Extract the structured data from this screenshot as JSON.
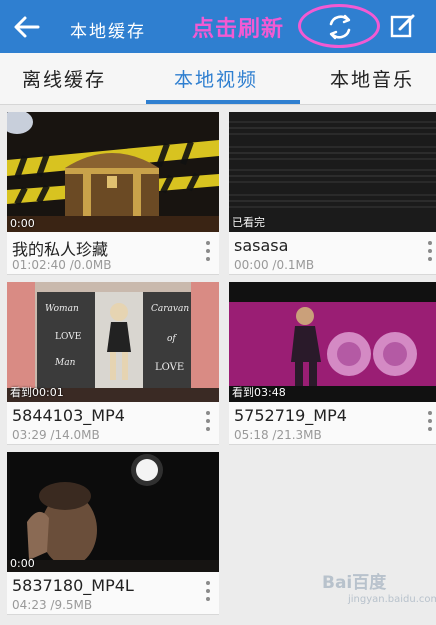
{
  "header": {
    "title": "本地缓存",
    "annotation": "点击刷新"
  },
  "tabs": [
    {
      "label": "离线缓存"
    },
    {
      "label": "本地视频"
    },
    {
      "label": "本地音乐"
    }
  ],
  "videos": [
    {
      "title": "我的私人珍藏",
      "meta": "01:02:40 /0.0MB",
      "status": "0:00"
    },
    {
      "title": "sasasa",
      "meta": "00:00 /0.1MB",
      "status": "已看完"
    },
    {
      "title": "5844103_MP4",
      "meta": "03:29 /14.0MB",
      "status": "看到00:01"
    },
    {
      "title": "5752719_MP4",
      "meta": "05:18 /21.3MB",
      "status": "看到03:48"
    },
    {
      "title": "5837180_MP4L",
      "meta": "04:23 /9.5MB",
      "status": "0:00"
    }
  ],
  "thumbnail_overlay_text": {
    "woman": "Woman",
    "love": "LOVE",
    "man": "Man",
    "caravan": "Caravan",
    "of": "of",
    "love2": "LOVE"
  },
  "watermark": {
    "brand": "Bai百度",
    "sub": "jingyan.baidu.com"
  },
  "colors": {
    "accent": "#2f7fd0",
    "annotation": "#f25ad3"
  }
}
